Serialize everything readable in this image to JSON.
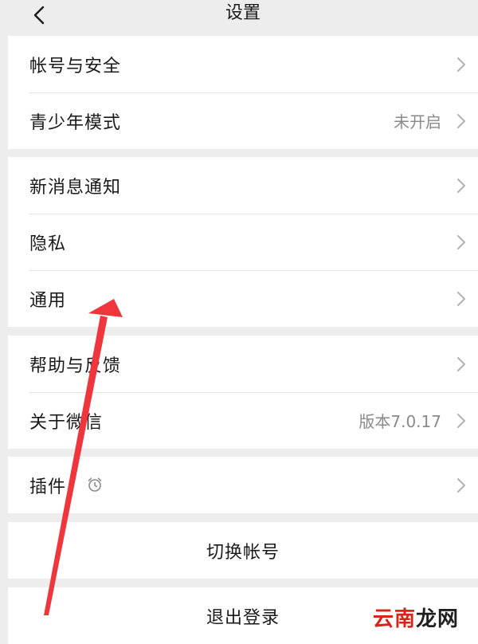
{
  "header": {
    "title": "设置",
    "back_icon": "chevron-left-icon"
  },
  "groups": [
    {
      "items": [
        {
          "label": "帐号与安全",
          "value": ""
        },
        {
          "label": "青少年模式",
          "value": "未开启"
        }
      ]
    },
    {
      "items": [
        {
          "label": "新消息通知",
          "value": ""
        },
        {
          "label": "隐私",
          "value": ""
        },
        {
          "label": "通用",
          "value": ""
        }
      ]
    },
    {
      "items": [
        {
          "label": "帮助与反馈",
          "value": ""
        },
        {
          "label": "关于微信",
          "value": "版本7.0.17"
        }
      ]
    },
    {
      "items": [
        {
          "label": "插件",
          "value": "",
          "icon": "alarm-clock-icon"
        }
      ]
    }
  ],
  "actions": {
    "switch_account": "切换帐号",
    "logout": "退出登录"
  },
  "annotation": {
    "arrow_color": "#f0363d"
  },
  "watermark": {
    "part1": "云南",
    "part2": "龙网",
    "color1": "#d9241c",
    "color2": "#1f1f1f"
  },
  "colors": {
    "background": "#ededed",
    "card": "#ffffff",
    "secondary_text": "#8a8a8a"
  }
}
